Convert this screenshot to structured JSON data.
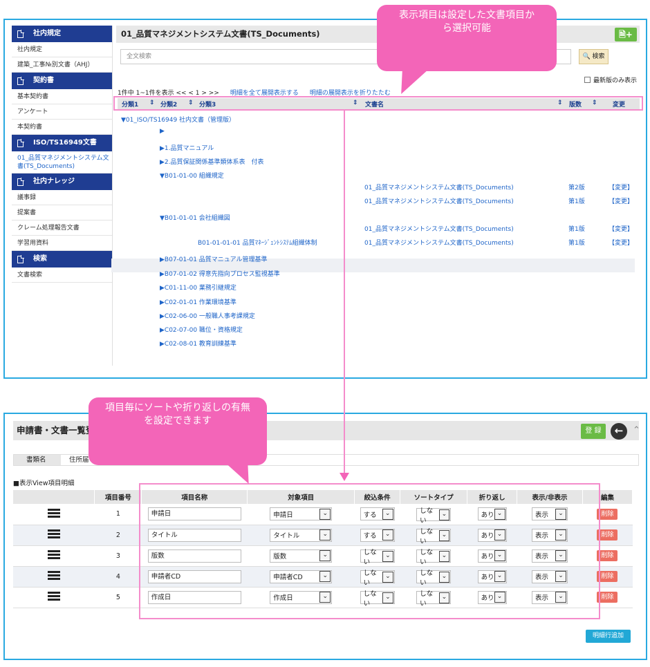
{
  "sidebar": [
    {
      "header": "社内規定",
      "items": [
        "社内規定",
        "建築_工事№別文書（AHJ）"
      ]
    },
    {
      "header": "契約書",
      "items": [
        "基本契約書",
        "アンケート",
        "本契約書"
      ]
    },
    {
      "header": "ISO/TS16949文書",
      "items": [
        "01_品質マネジメントシステム文書(TS_Documents)"
      ]
    },
    {
      "header": "社内ナレッジ",
      "items": [
        "議事録",
        "提案書",
        "クレーム処理報告文書",
        "学習用資料"
      ]
    },
    {
      "header": "検索",
      "items": [
        "文書検索"
      ]
    }
  ],
  "main": {
    "title": "01_品質マネジメントシステム文書(TS_Documents)",
    "add_icon": "document-add-icon",
    "search_placeholder": "全文検索",
    "search_button": "検索",
    "latest_only": "最新版のみ表示",
    "paging": "1件中 1~1件を表示 << < 1 > >>",
    "expand_all": "明細を全て展開表示する",
    "collapse_all": "明細の展開表示を折りたたむ",
    "columns": {
      "c1": "分類1",
      "c2": "分類2",
      "c3": "分類3",
      "c4": "文書名",
      "c5": "版数",
      "c6": "変更"
    },
    "tree": {
      "t1": "▼01_ISO/TS16949 社内文書（管理版）",
      "t2": "▶",
      "t3": "▶1.品質マニュアル",
      "t4": "▶2.品質保証関係基準類体系表　付表",
      "t5": "▼B01-01-00 組織規定",
      "t6": "▼B01-01-01 会社組織図",
      "t7": "B01-01-01-01 品質ﾏﾈｰｼﾞｪﾝﾄｼｽﾃﾑ組織体制",
      "t8": "▶B07-01-01 品質マニュアル管理基準",
      "t9": "▶B07-01-02 得意先指向プロセス監視基準",
      "t10": "▶C01-11-00 業務引継規定",
      "t11": "▶C02-01-01 作業環境基準",
      "t12": "▶C02-06-00 一般職人事考課規定",
      "t13": "▶C02-07-00 職位・資格規定",
      "t14": "▶C02-08-01 教育訓練基準"
    },
    "docs": [
      {
        "name": "01_品質マネジメントシステム文書(TS_Documents)",
        "ver": "第2版",
        "change": "【変更】"
      },
      {
        "name": "01_品質マネジメントシステム文書(TS_Documents)",
        "ver": "第1版",
        "change": "【変更】"
      },
      {
        "name": "01_品質マネジメントシステム文書(TS_Documents)",
        "ver": "第1版",
        "change": "【変更】"
      },
      {
        "name": "01_品質マネジメントシステム文書(TS_Documents)",
        "ver": "第1版",
        "change": "【変更】"
      }
    ]
  },
  "callouts": {
    "top": "表示項目は設定した文書項目から選択可能",
    "bottom": "項目毎にソートや折り返しの有無を設定できます"
  },
  "form": {
    "title": "申請書・文書一覧登録",
    "register": "登 録",
    "back_icon": "back-arrow-icon",
    "doc_type_label": "書類名",
    "doc_type_value": "住所届",
    "section": "■表示View項目明細",
    "headers": [
      "",
      "項目番号",
      "項目名称",
      "対象項目",
      "絞込条件",
      "ソートタイプ",
      "折り返し",
      "表示/非表示",
      "編集"
    ],
    "rows": [
      {
        "no": "1",
        "name": "申請日",
        "target": "申請日",
        "filter": "する",
        "sort": "しない",
        "wrap": "あり",
        "show": "表示",
        "del": "削除"
      },
      {
        "no": "2",
        "name": "タイトル",
        "target": "タイトル",
        "filter": "する",
        "sort": "しない",
        "wrap": "あり",
        "show": "表示",
        "del": "削除"
      },
      {
        "no": "3",
        "name": "版数",
        "target": "版数",
        "filter": "しない",
        "sort": "しない",
        "wrap": "あり",
        "show": "表示",
        "del": "削除"
      },
      {
        "no": "4",
        "name": "申請者CD",
        "target": "申請者CD",
        "filter": "しない",
        "sort": "しない",
        "wrap": "あり",
        "show": "表示",
        "del": "削除"
      },
      {
        "no": "5",
        "name": "作成日",
        "target": "作成日",
        "filter": "しない",
        "sort": "しない",
        "wrap": "あり",
        "show": "表示",
        "del": "削除"
      }
    ],
    "add_row": "明細行追加"
  },
  "colors": {
    "accent": "#29a9e1",
    "nav": "#1f3d92",
    "callout": "#f365b8",
    "green": "#6abb45",
    "delete": "#ec6e61"
  }
}
